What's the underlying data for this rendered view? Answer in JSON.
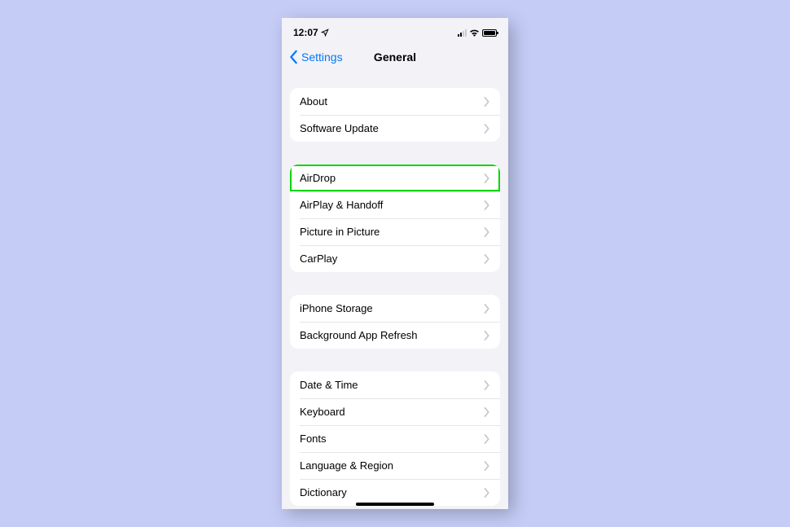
{
  "status": {
    "time": "12:07"
  },
  "nav": {
    "back_label": "Settings",
    "title": "General"
  },
  "groups": [
    {
      "items": [
        "About",
        "Software Update"
      ]
    },
    {
      "items": [
        "AirDrop",
        "AirPlay & Handoff",
        "Picture in Picture",
        "CarPlay"
      ],
      "highlight_index": 0
    },
    {
      "items": [
        "iPhone Storage",
        "Background App Refresh"
      ]
    },
    {
      "items": [
        "Date & Time",
        "Keyboard",
        "Fonts",
        "Language & Region",
        "Dictionary"
      ]
    }
  ]
}
